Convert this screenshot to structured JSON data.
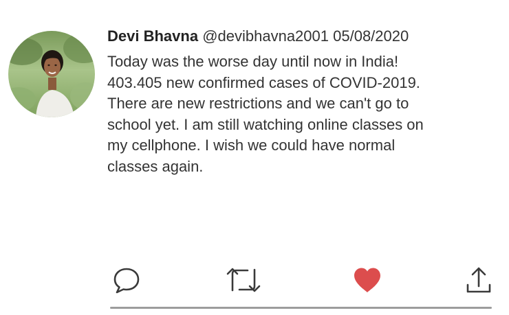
{
  "tweet": {
    "author": {
      "display_name": "Devi Bhavna",
      "handle": "@devibhavna2001",
      "date": "05/08/2020"
    },
    "text_lines": [
      "Today was the worse day until now in India!",
      "403.405 new confirmed cases of COVID-2019.",
      "There are new restrictions and we can't go to",
      "school yet. I am still watching online classes on",
      "my cellphone. I wish we could have normal",
      "classes again."
    ],
    "liked": true
  },
  "actions": [
    {
      "name": "reply",
      "icon": "speech-bubble-icon"
    },
    {
      "name": "retweet",
      "icon": "retweet-arrows-icon"
    },
    {
      "name": "like",
      "icon": "heart-icon"
    },
    {
      "name": "share",
      "icon": "upload-share-icon"
    }
  ],
  "colors": {
    "text": "#333333",
    "name": "#222222",
    "icon": "#3a3a3a",
    "like": "#dc4d4d",
    "divider": "#9c9c9c"
  }
}
